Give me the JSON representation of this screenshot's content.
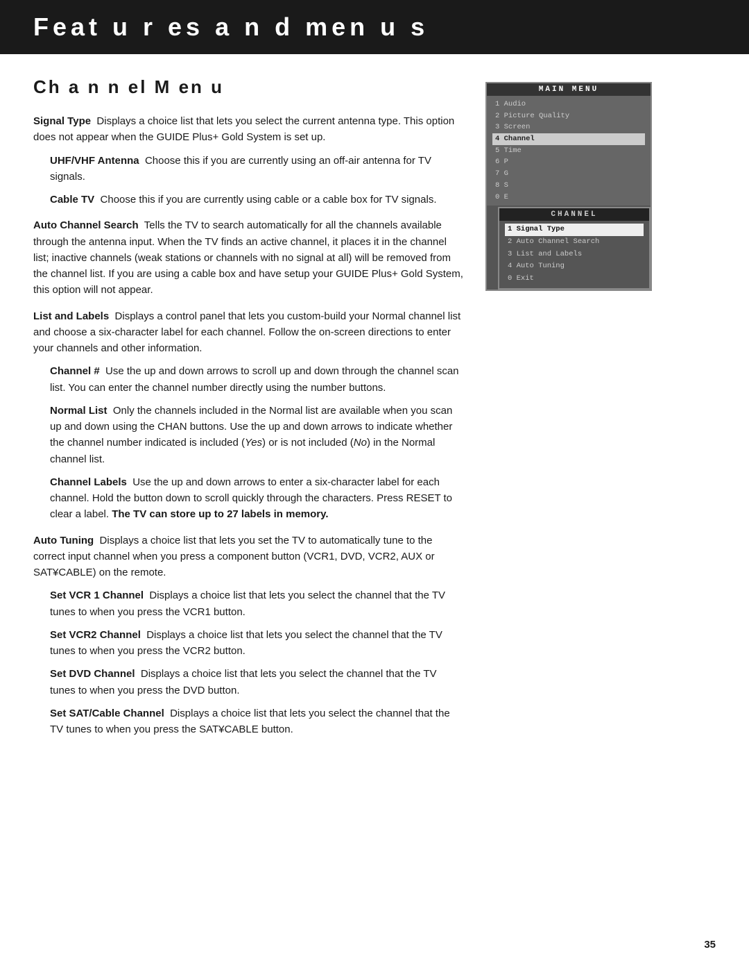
{
  "header": {
    "title": "Feat u r es a n d  men u s"
  },
  "chapter": {
    "title": "Ch a n n el  M en u"
  },
  "sections": [
    {
      "id": "signal-type",
      "term": "Signal Type",
      "body": "Displays a choice list that lets you select the current antenna type. This option does not appear when the GUIDE Plus+ Gold System is set up."
    },
    {
      "id": "uhf-vhf",
      "term": "UHF/VHF Antenna",
      "body": "Choose this if you are currently using an off-air antenna for TV signals.",
      "indent": true
    },
    {
      "id": "cable-tv",
      "term": "Cable TV",
      "body": "Choose this if you are currently using cable or a cable box for TV signals.",
      "indent": true
    },
    {
      "id": "auto-channel-search",
      "term": "Auto Channel Search",
      "body": "Tells the TV to search automatically for all the channels available through the antenna input. When the TV finds an active channel, it places it in the channel list; inactive channels (weak stations or channels with no signal at all) will be removed from the channel list. If you are using a cable box and have setup your GUIDE Plus+ Gold System, this option will not appear."
    },
    {
      "id": "list-and-labels",
      "term": "List and Labels",
      "body": "Displays a control panel that lets you custom-build your Normal channel list and choose a six-character label for each channel. Follow the on-screen directions to enter your channels and other information."
    },
    {
      "id": "channel-hash",
      "term": "Channel #",
      "body": "Use the up and down arrows to scroll up and down through the channel scan list. You can enter the channel number directly using the number buttons.",
      "indent": true
    },
    {
      "id": "normal-list",
      "term": "Normal List",
      "body": "Only the channels included in the Normal list are available when you scan up and down using the CHAN buttons. Use the up and down arrows to indicate whether the channel number indicated is included (Yes) or is not included (No) in the Normal channel list.",
      "indent": true
    },
    {
      "id": "channel-labels",
      "term": "Channel Labels",
      "body": "Use the up and down arrows to enter a six-character label for each channel. Hold the button down to scroll quickly through the characters. Press RESET to clear a label.",
      "bold_suffix": "The TV can store up to 27 labels in memory.",
      "indent": true
    },
    {
      "id": "auto-tuning",
      "term": "Auto Tuning",
      "body": "Displays a choice list that lets you set the TV to automatically tune to the correct input channel when you press a component button (VCR1, DVD, VCR2, AUX or SAT¥CABLE) on the remote."
    },
    {
      "id": "set-vcr1",
      "term": "Set VCR 1 Channel",
      "body": "Displays a choice list that lets you select the channel that the TV tunes to when you press the VCR1 button.",
      "indent": true
    },
    {
      "id": "set-vcr2",
      "term": "Set VCR2 Channel",
      "body": "Displays a choice list that lets you select the channel that the TV tunes to when you press the VCR2 button.",
      "indent": true
    },
    {
      "id": "set-dvd",
      "term": "Set DVD Channel",
      "body": "Displays a choice list that lets you select the channel that the TV tunes to when you press the DVD button.",
      "indent": true
    },
    {
      "id": "set-sat",
      "term": "Set SAT/Cable Channel",
      "body": "Displays a choice list that lets you select the channel that the TV tunes to when you press the SAT¥CABLE button.",
      "indent": true
    }
  ],
  "tv_menu": {
    "main_menu": {
      "title": "MAIN MENU",
      "items": [
        {
          "num": "1",
          "label": "Audio",
          "highlighted": false
        },
        {
          "num": "2",
          "label": "Picture Quality",
          "highlighted": false
        },
        {
          "num": "3",
          "label": "Screen",
          "highlighted": false
        },
        {
          "num": "4",
          "label": "Channel",
          "highlighted": true
        },
        {
          "num": "5",
          "label": "Time",
          "highlighted": false
        },
        {
          "num": "6",
          "label": "P",
          "highlighted": false
        },
        {
          "num": "7",
          "label": "G",
          "highlighted": false
        },
        {
          "num": "8",
          "label": "S",
          "highlighted": false
        },
        {
          "num": "0",
          "label": "E",
          "highlighted": false
        }
      ]
    },
    "channel_menu": {
      "title": "CHANNEL",
      "items": [
        {
          "num": "1",
          "label": "Signal Type",
          "highlighted": true
        },
        {
          "num": "2",
          "label": "Auto Channel Search",
          "highlighted": false
        },
        {
          "num": "3",
          "label": "List and Labels",
          "highlighted": false
        },
        {
          "num": "4",
          "label": "Auto Tuning",
          "highlighted": false
        },
        {
          "num": "0",
          "label": "Exit",
          "highlighted": false
        }
      ]
    }
  },
  "page_number": "35"
}
